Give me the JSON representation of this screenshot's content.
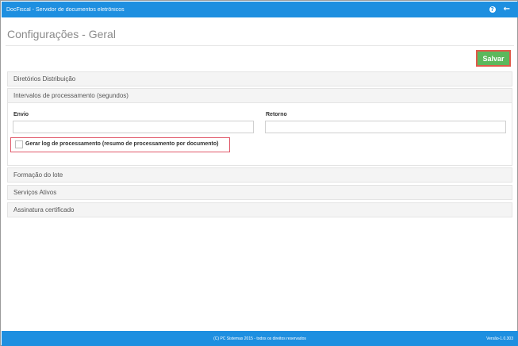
{
  "topbar": {
    "title": "DocFiscal - Servidor de documentos eletrônicos",
    "help_icon": "help-circle-icon",
    "back_icon": "arrow-left-icon",
    "help_glyph": "?",
    "back_glyph": "←"
  },
  "page": {
    "title": "Configurações - Geral"
  },
  "toolbar": {
    "save_label": "Salvar"
  },
  "sections": {
    "diretorios": "Diretórios Distribuição",
    "intervalos": "Intervalos de processamento (segundos)",
    "formacao": "Formação do lote",
    "servicos": "Serviços Ativos",
    "assinatura": "Assinatura certificado"
  },
  "intervalos": {
    "envio_label": "Envio",
    "envio_value": "",
    "retorno_label": "Retorno",
    "retorno_value": "",
    "log_checkbox_label": "Gerar log de processamento (resumo de processamento por documento)",
    "log_checked": false
  },
  "footer": {
    "copyright": "(C) PC Sistemas 2015 - todos os direitos reservados",
    "version": "Versão-1.0.303"
  },
  "colors": {
    "topbar": "#1e8fe0",
    "save_button": "#5cb85c",
    "highlight": "#e05a4a"
  }
}
